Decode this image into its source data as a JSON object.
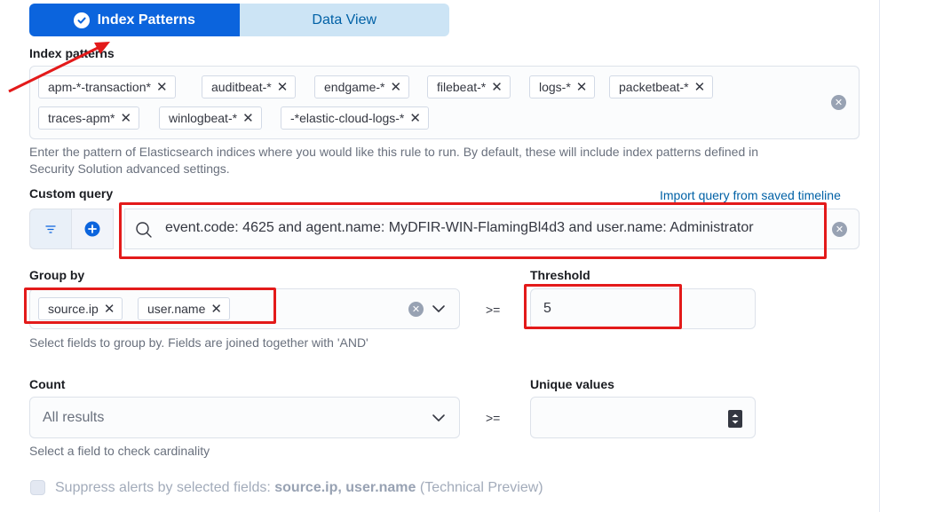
{
  "toggle": {
    "active_label": "Index Patterns",
    "inactive_label": "Data View"
  },
  "index_patterns": {
    "label": "Index patterns",
    "pills": [
      "apm-*-transaction*",
      "auditbeat-*",
      "endgame-*",
      "filebeat-*",
      "logs-*",
      "packetbeat-*",
      "traces-apm*",
      "winlogbeat-*",
      "-*elastic-cloud-logs-*"
    ],
    "help_line1": "Enter the pattern of Elasticsearch indices where you would like this rule to run. By default, these will include index patterns defined in",
    "help_line2": "Security Solution advanced settings."
  },
  "custom_query": {
    "label": "Custom query",
    "import_link": "Import query from saved timeline",
    "value": "event.code: 4625 and agent.name: MyDFIR-WIN-FlamingBl4d3 and user.name: Administrator"
  },
  "group_by": {
    "label": "Group by",
    "pills": [
      "source.ip",
      "user.name"
    ],
    "help": "Select fields to group by. Fields are joined together with 'AND'"
  },
  "threshold": {
    "label": "Threshold",
    "operator": ">=",
    "value": "5"
  },
  "count": {
    "label": "Count",
    "selected": "All results",
    "help": "Select a field to check cardinality"
  },
  "unique_values": {
    "label": "Unique values",
    "operator": ">=",
    "value": ""
  },
  "suppress": {
    "prefix": "Suppress alerts by selected fields:",
    "fields": "source.ip, user.name",
    "suffix": "(Technical Preview)"
  },
  "colors": {
    "primary": "#0b64dd",
    "annotation_red": "#e31a1a"
  }
}
